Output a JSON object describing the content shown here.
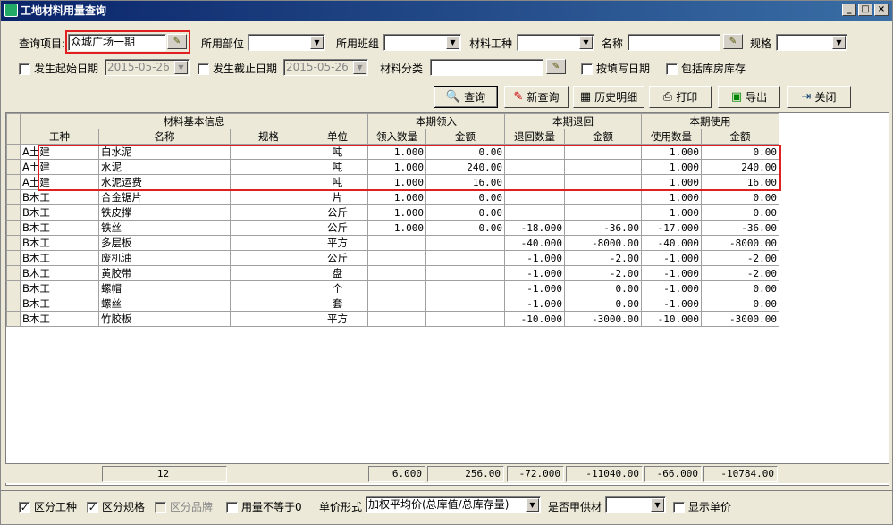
{
  "title": "工地材料用量查询",
  "window_buttons": [
    "_",
    "□",
    "×"
  ],
  "filters": {
    "project_label": "查询项目",
    "project_value": "众城广场一期",
    "dept_label": "所用部位",
    "dept_value": "",
    "team_label": "所用班组",
    "team_value": "",
    "worktype_label": "材料工种",
    "worktype_value": "",
    "name_label": "名称",
    "name_value": "",
    "spec_label": "规格",
    "spec_value": "",
    "start_label": "发生起始日期",
    "start_value": "2015-05-26",
    "end_label": "发生截止日期",
    "end_value": "2015-05-26",
    "category_label": "材料分类",
    "category_value": "",
    "by_fill_date_label": "按填写日期",
    "include_store_label": "包括库房库存"
  },
  "toolbar": {
    "query": "查询",
    "new_query": "新查询",
    "history": "历史明细",
    "print": "打印",
    "export": "导出",
    "close": "关闭"
  },
  "table": {
    "groups": [
      "材料基本信息",
      "本期领入",
      "本期退回",
      "本期使用"
    ],
    "columns": [
      "工种",
      "名称",
      "规格",
      "单位",
      "领入数量",
      "金额",
      "退回数量",
      "金额",
      "使用数量",
      "金额"
    ],
    "rows": [
      [
        "A土建",
        "白水泥",
        "",
        "吨",
        "1.000",
        "0.00",
        "",
        "",
        "1.000",
        "0.00"
      ],
      [
        "A土建",
        "水泥",
        "",
        "吨",
        "1.000",
        "240.00",
        "",
        "",
        "1.000",
        "240.00"
      ],
      [
        "A土建",
        "水泥运费",
        "",
        "吨",
        "1.000",
        "16.00",
        "",
        "",
        "1.000",
        "16.00"
      ],
      [
        "B木工",
        "合金锯片",
        "",
        "片",
        "1.000",
        "0.00",
        "",
        "",
        "1.000",
        "0.00"
      ],
      [
        "B木工",
        "铁皮撑",
        "",
        "公斤",
        "1.000",
        "0.00",
        "",
        "",
        "1.000",
        "0.00"
      ],
      [
        "B木工",
        "铁丝",
        "",
        "公斤",
        "1.000",
        "0.00",
        "-18.000",
        "-36.00",
        "-17.000",
        "-36.00"
      ],
      [
        "B木工",
        "多层板",
        "",
        "平方",
        "",
        "",
        "-40.000",
        "-8000.00",
        "-40.000",
        "-8000.00"
      ],
      [
        "B木工",
        "废机油",
        "",
        "公斤",
        "",
        "",
        "-1.000",
        "-2.00",
        "-1.000",
        "-2.00"
      ],
      [
        "B木工",
        "黄胶带",
        "",
        "盘",
        "",
        "",
        "-1.000",
        "-2.00",
        "-1.000",
        "-2.00"
      ],
      [
        "B木工",
        "螺帽",
        "",
        "个",
        "",
        "",
        "-1.000",
        "0.00",
        "-1.000",
        "0.00"
      ],
      [
        "B木工",
        "螺丝",
        "",
        "套",
        "",
        "",
        "-1.000",
        "0.00",
        "-1.000",
        "0.00"
      ],
      [
        "B木工",
        "竹胶板",
        "",
        "平方",
        "",
        "",
        "-10.000",
        "-3000.00",
        "-10.000",
        "-3000.00"
      ]
    ]
  },
  "footer": {
    "count": "12",
    "in_qty": "6.000",
    "in_amt": "256.00",
    "ret_qty": "-72.000",
    "ret_amt": "-11040.00",
    "use_qty": "-66.000",
    "use_amt": "-10784.00"
  },
  "bottom": {
    "by_worktype": "区分工种",
    "by_spec": "区分规格",
    "by_brand": "区分品牌",
    "qty_ne_zero": "用量不等于0",
    "price_form_label": "单价形式",
    "price_form_value": "加权平均价(总库值/总库存量)",
    "supplier_label": "是否甲供材",
    "supplier_value": "",
    "show_price": "显示单价"
  }
}
